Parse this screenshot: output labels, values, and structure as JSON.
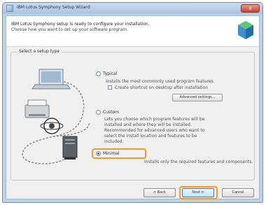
{
  "window": {
    "title": "IBM Lotus Symphony Setup Wizard",
    "close_label": "x"
  },
  "header": {
    "line1": "IBM Lotus Symphony setup is ready to configure your installation.",
    "line2": "Choose how you want to set up your software program."
  },
  "group": {
    "label": "Select a setup type",
    "options": [
      {
        "label": "Typical",
        "description_line1": "Installs the most commonly used program features.",
        "checkbox_label": "Create shortcut on desktop after installation",
        "checked": false,
        "button_label": "Advanced settings..."
      },
      {
        "label": "Custom",
        "description": "Lets you choose which program features will be installed and where they will be installed. Recommended for advanced users who want to select the install location and features to be included."
      },
      {
        "label": "Minimal",
        "description": "Installs only the required features and components."
      }
    ],
    "selected_index": 2
  },
  "footer": {
    "back_label": "< Back",
    "next_label": "Next >",
    "cancel_label": "Cancel"
  },
  "colors": {
    "highlight": "#f29a2e",
    "accent": "#2a6bbf"
  }
}
